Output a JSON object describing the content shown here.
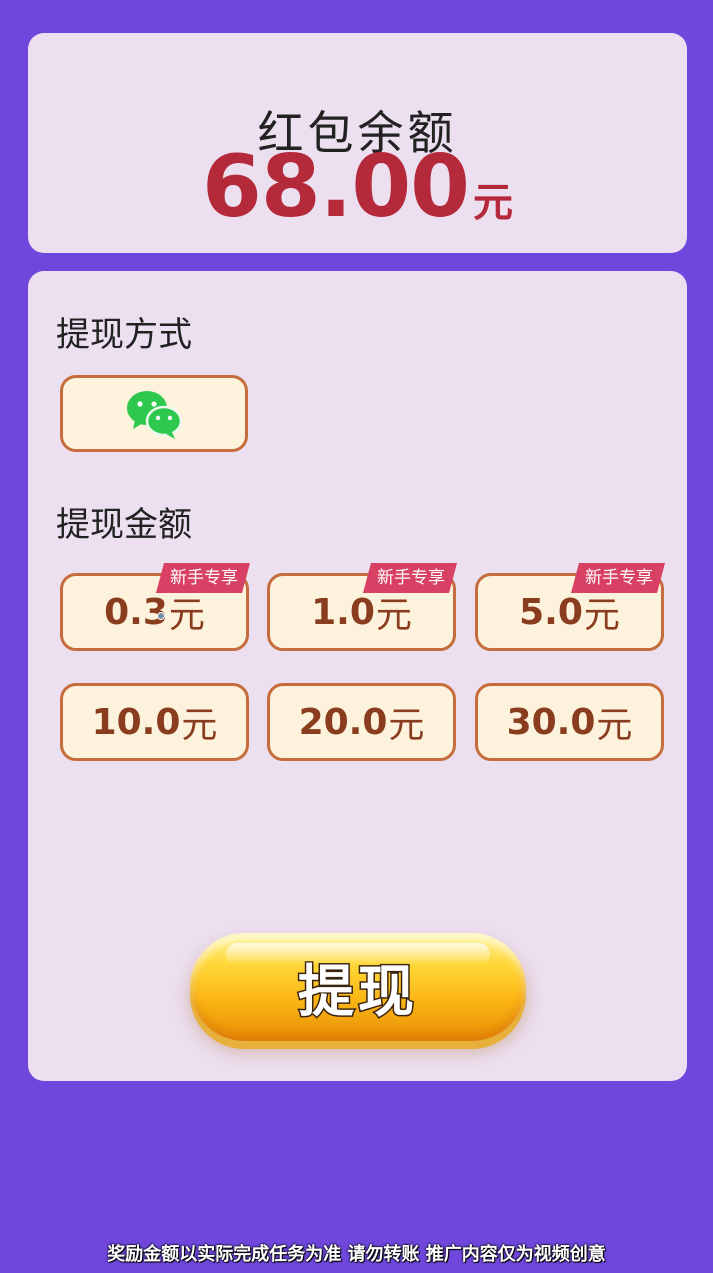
{
  "balance": {
    "title": "红包余额",
    "amount": "68.00",
    "unit": "元"
  },
  "withdraw": {
    "method_label": "提现方式",
    "method_icon": "wechat-icon",
    "amount_label": "提现金额",
    "options": [
      {
        "value": "0.3",
        "unit": "元",
        "tag": "新手专享"
      },
      {
        "value": "1.0",
        "unit": "元",
        "tag": "新手专享"
      },
      {
        "value": "5.0",
        "unit": "元",
        "tag": "新手专享"
      },
      {
        "value": "10.0",
        "unit": "元",
        "tag": ""
      },
      {
        "value": "20.0",
        "unit": "元",
        "tag": ""
      },
      {
        "value": "30.0",
        "unit": "元",
        "tag": ""
      }
    ],
    "button_label": "提现"
  },
  "footer": {
    "note": "奖励金额以实际完成任务为准 请勿转账 推广内容仅为视频创意"
  },
  "colors": {
    "background": "#6f47dc",
    "card": "#ecdff0",
    "accent_red": "#b52a3b",
    "tag": "#d84064",
    "option_border": "#c56d3c",
    "wechat_green": "#2dc84d"
  }
}
